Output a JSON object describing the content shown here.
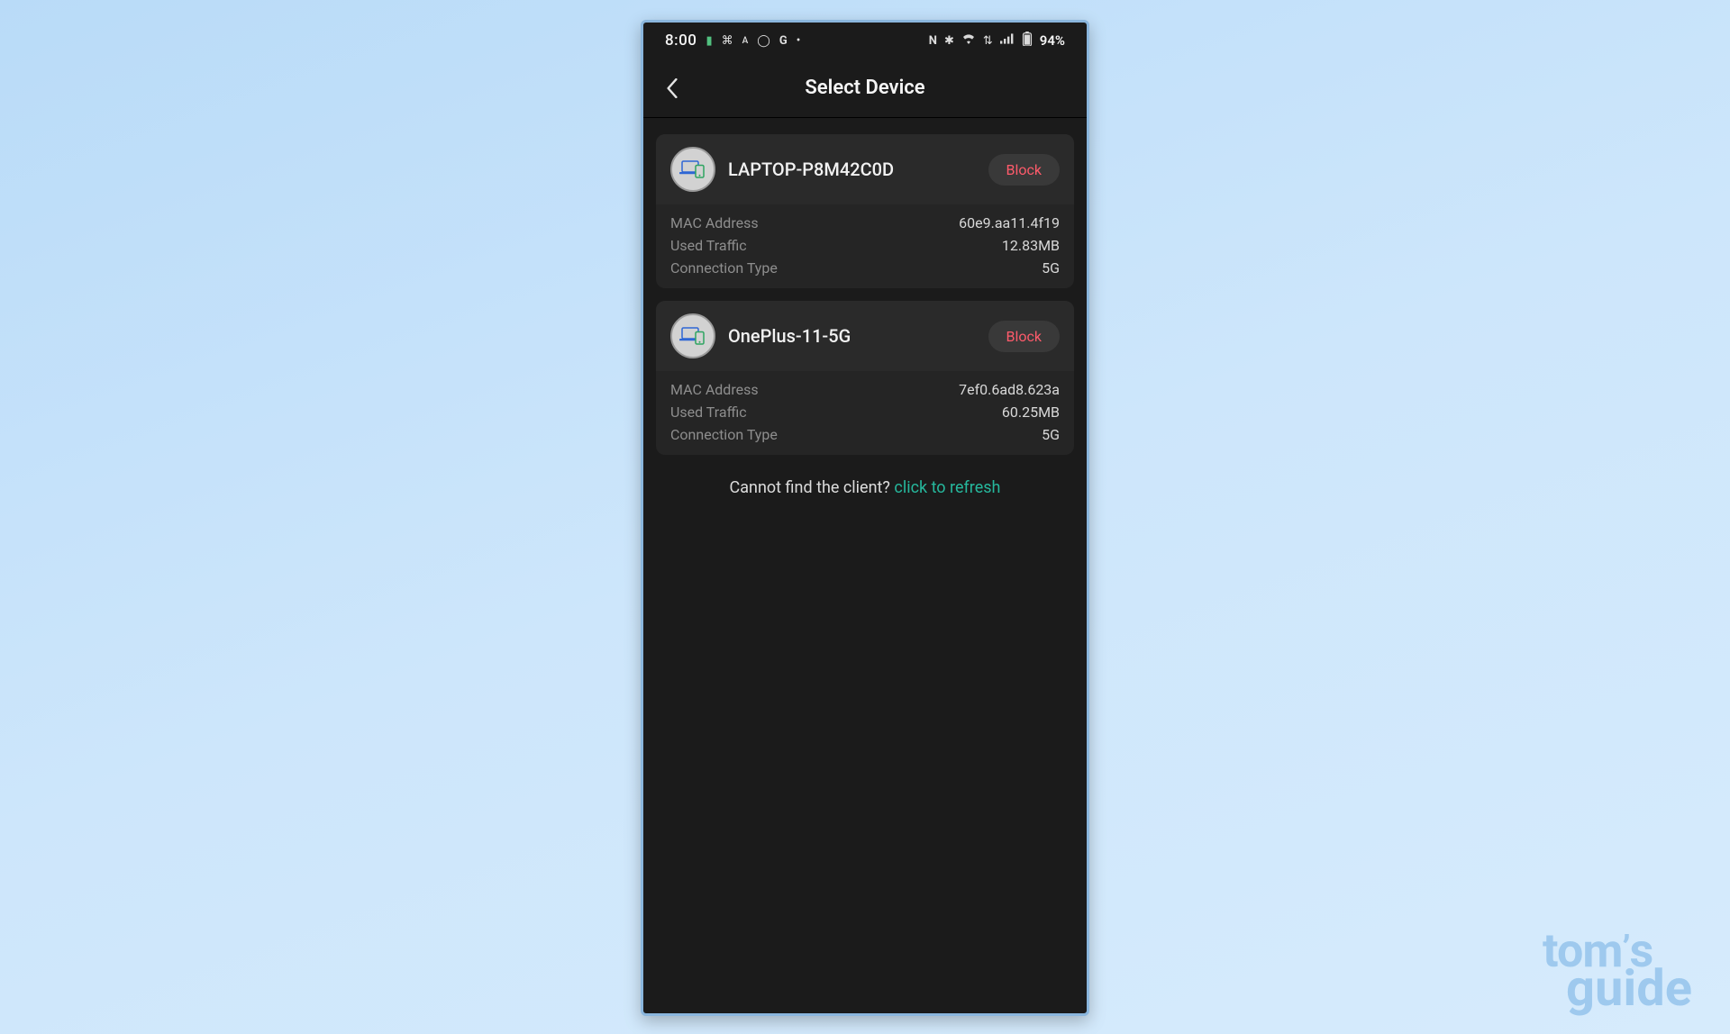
{
  "status": {
    "clock": "8:00",
    "battery": "94%"
  },
  "header": {
    "title": "Select Device"
  },
  "labels": {
    "mac": "MAC Address",
    "traffic": "Used Traffic",
    "conn": "Connection Type",
    "block": "Block",
    "refresh_prompt": "Cannot find the client? ",
    "refresh_link": "click to refresh"
  },
  "devices": [
    {
      "name": "LAPTOP-P8M42C0D",
      "mac": "60e9.aa11.4f19",
      "traffic": "12.83MB",
      "conn": "5G"
    },
    {
      "name": "OnePlus-11-5G",
      "mac": "7ef0.6ad8.623a",
      "traffic": "60.25MB",
      "conn": "5G"
    }
  ],
  "watermark": {
    "line1": "tom's",
    "line2": "guide"
  }
}
